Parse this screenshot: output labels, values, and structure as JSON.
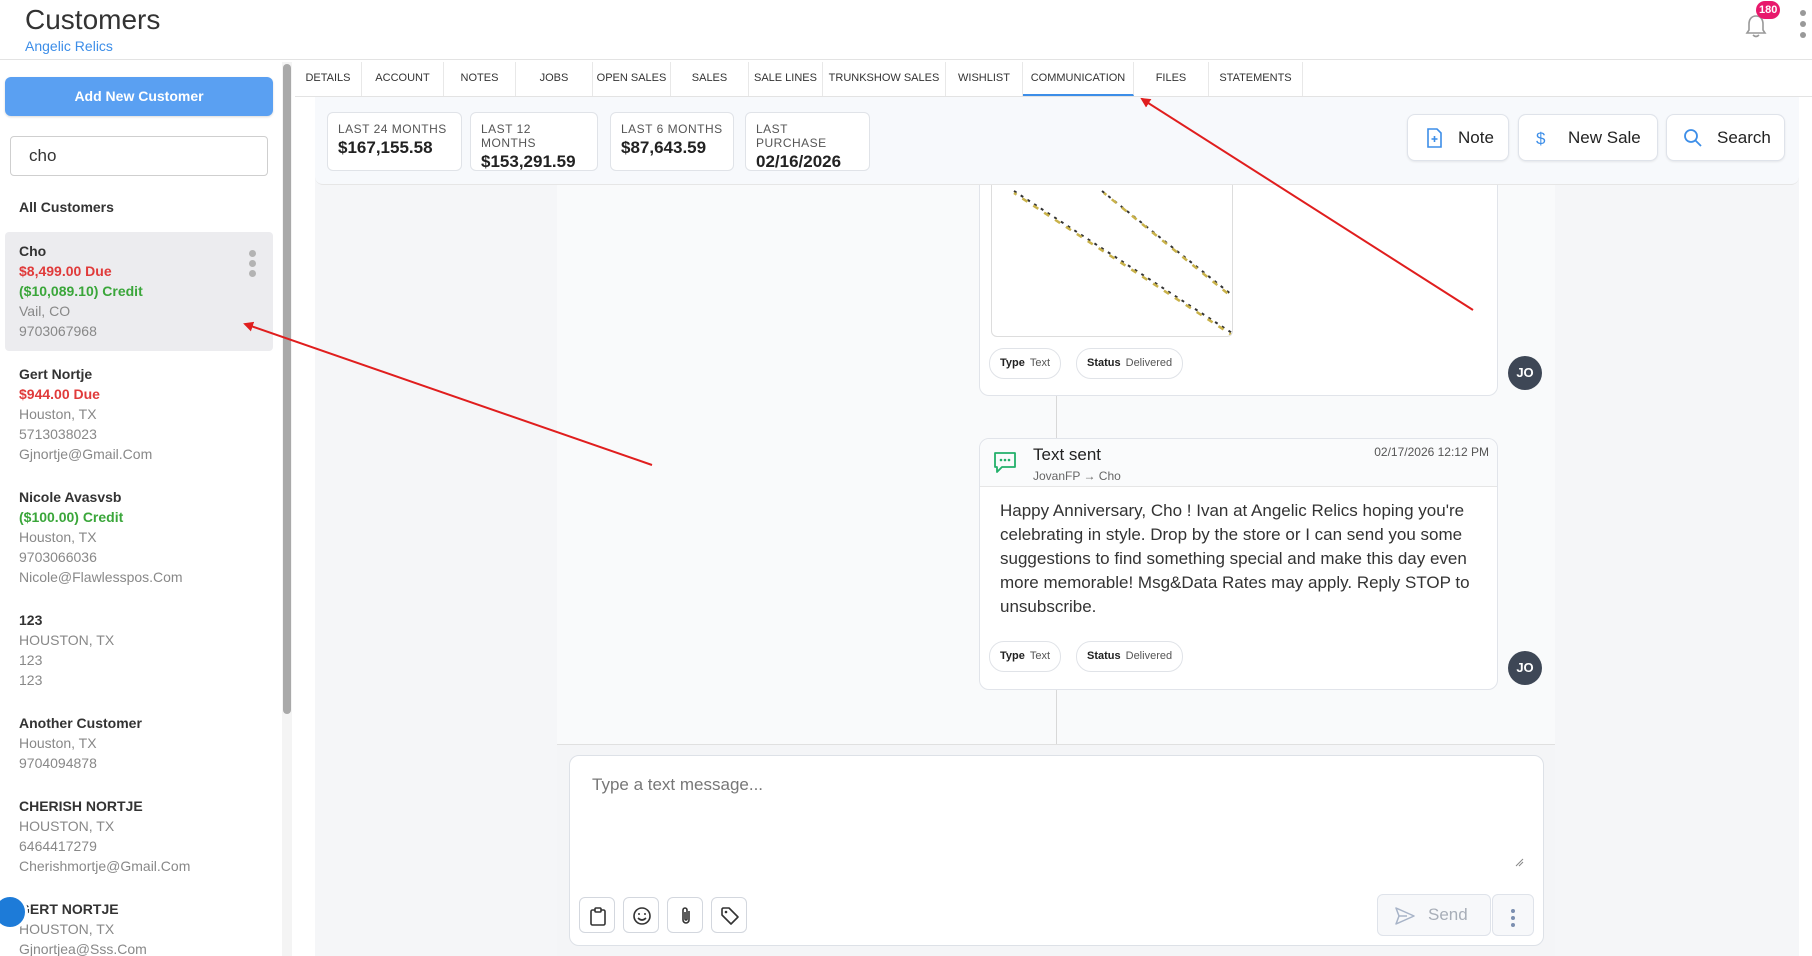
{
  "header": {
    "title": "Customers",
    "subtitle": "Angelic Relics",
    "notification_count": "180"
  },
  "sidebar": {
    "add_button": "Add New Customer",
    "search_value": "cho",
    "all_customers_label": "All Customers",
    "customers": [
      {
        "name": "Cho",
        "due": "$8,499.00 Due",
        "credit": "($10,089.10) Credit",
        "location": "Vail, CO",
        "phone": "9703067968",
        "email": ""
      },
      {
        "name": "Gert Nortje",
        "due": "$944.00 Due",
        "credit": "",
        "location": "Houston, TX",
        "phone": "5713038023",
        "email": "Gjnortje@Gmail.Com"
      },
      {
        "name": "Nicole Avasvsb",
        "due": "",
        "credit": "($100.00) Credit",
        "location": "Houston, TX",
        "phone": "9703066036",
        "email": "Nicole@Flawlesspos.Com"
      },
      {
        "name": "123",
        "due": "",
        "credit": "",
        "location": "HOUSTON, TX",
        "phone": "123",
        "email": "123"
      },
      {
        "name": "Another Customer",
        "due": "",
        "credit": "",
        "location": "Houston, TX",
        "phone": "9704094878",
        "email": ""
      },
      {
        "name": "CHERISH NORTJE",
        "due": "",
        "credit": "",
        "location": "HOUSTON, TX",
        "phone": "6464417279",
        "email": "Cherishmortje@Gmail.Com"
      },
      {
        "name": "GERT NORTJE",
        "due": "",
        "credit": "",
        "location": "HOUSTON, TX",
        "phone": "",
        "email": "Gjnortjea@Sss.Com"
      }
    ]
  },
  "tabs": [
    "DETAILS",
    "ACCOUNT",
    "NOTES",
    "JOBS",
    "OPEN SALES",
    "SALES",
    "SALE LINES",
    "TRUNKSHOW SALES",
    "WISHLIST",
    "COMMUNICATION",
    "FILES",
    "STATEMENTS"
  ],
  "active_tab": "COMMUNICATION",
  "stats": [
    {
      "label": "LAST 24 MONTHS",
      "value": "$167,155.58"
    },
    {
      "label": "LAST 12 MONTHS",
      "value": "$153,291.59"
    },
    {
      "label": "LAST 6 MONTHS",
      "value": "$87,643.59"
    },
    {
      "label": "LAST PURCHASE",
      "value": "02/16/2026"
    }
  ],
  "actions": {
    "note": "Note",
    "new_sale": "New Sale",
    "search": "Search"
  },
  "messages": [
    {
      "type_label": "Type",
      "type_value": "Text",
      "status_label": "Status",
      "status_value": "Delivered",
      "avatar": "JO"
    },
    {
      "title": "Text sent",
      "route": "JovanFP → Cho",
      "timestamp": "02/17/2026 12:12 PM",
      "body": "Happy Anniversary, Cho ! Ivan at Angelic Relics hoping you're celebrating in style. Drop by the store or I can send you some suggestions to find something special and make this day even more memorable! Msg&Data Rates may apply. Reply STOP to unsubscribe.",
      "type_label": "Type",
      "type_value": "Text",
      "status_label": "Status",
      "status_value": "Delivered",
      "avatar": "JO"
    }
  ],
  "composer": {
    "placeholder": "Type a text message...",
    "send_label": "Send"
  },
  "colors": {
    "accent": "#3d8ee8",
    "add_button": "#5aa0f2",
    "due": "#e03a3a",
    "credit": "#3aa63a",
    "annotation_arrow": "#e01e1e"
  }
}
